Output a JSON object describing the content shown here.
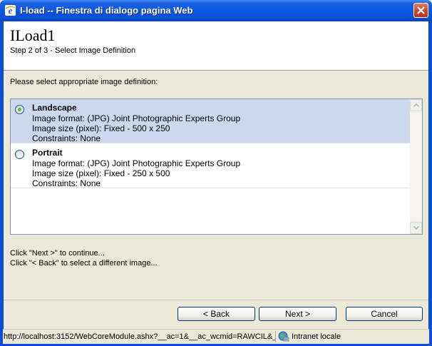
{
  "window": {
    "title": "I-load -- Finestra di dialogo pagina Web",
    "icons": {
      "app": "ie-icon",
      "close": "close-icon"
    },
    "colors": {
      "titlebar": "#0a58e6",
      "selected_row": "#cbd8ee"
    }
  },
  "header": {
    "title": "ILoad1",
    "step": "Step 2 of 3 - Select Image Definition"
  },
  "prompt": "Please select appropriate image definition:",
  "definitions": [
    {
      "name": "Landscape",
      "format": "Image format: (JPG) Joint Photographic Experts Group",
      "size": "Image size (pixel): Fixed - 500 x 250",
      "constraints": "Constraints: None",
      "selected": true
    },
    {
      "name": "Portrait",
      "format": "Image format: (JPG) Joint Photographic Experts Group",
      "size": "Image size (pixel): Fixed - 250 x 500",
      "constraints": "Constraints: None",
      "selected": false
    }
  ],
  "hints": {
    "next": "Click \"Next >\" to continue...",
    "back": "Click \"< Back\" to select a different image..."
  },
  "buttons": {
    "back": "< Back",
    "next": "Next >",
    "cancel": "Cancel"
  },
  "statusbar": {
    "url": "http://localhost:3152/WebCoreModule.ashx?__ac=1&__ac_wcmid=RAWCIL&_",
    "zone": "Intranet locale",
    "zone_icon": "intranet-globe-icon"
  }
}
